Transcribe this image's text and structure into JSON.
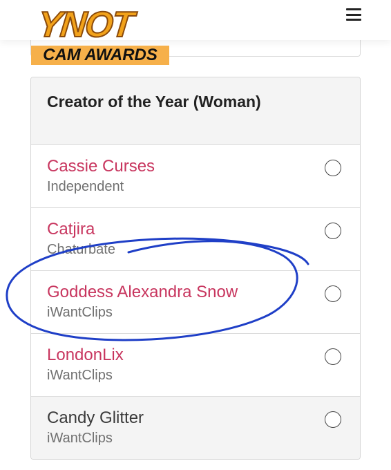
{
  "brand": {
    "logo_top": "YNOT",
    "logo_bottom": "CAM AWARDS"
  },
  "header": {
    "menu_icon": "hamburger-menu-icon"
  },
  "category": {
    "title": "Creator of the Year (Woman)"
  },
  "nominees": [
    {
      "name": "Cassie Curses",
      "platform": "Independent"
    },
    {
      "name": "Catjira",
      "platform": "Chaturbate"
    },
    {
      "name": "Goddess Alexandra Snow",
      "platform": "iWantClips"
    },
    {
      "name": "LondonLix",
      "platform": "iWantClips"
    },
    {
      "name": "Candy Glitter",
      "platform": "iWantClips"
    }
  ],
  "colors": {
    "nominee_name": "#c8365f",
    "annotation_ink": "#1f3fc7",
    "logo_gold": "#f2a21a",
    "logo_band": "#f6b04a"
  }
}
